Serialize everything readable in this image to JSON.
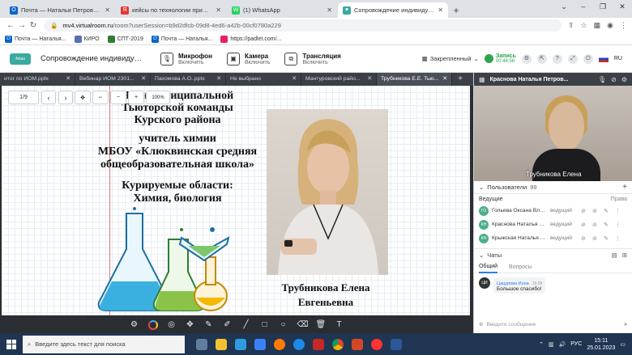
{
  "browser": {
    "tabs": [
      {
        "label": "Почта — Наталья Петровна Кра",
        "icon_color": "#0a64c8",
        "icon_text": "O"
      },
      {
        "label": "кейсы по технологии примеры",
        "icon_color": "#e53935",
        "icon_text": "Я"
      },
      {
        "label": "(1) WhatsApp",
        "icon_color": "#25d366",
        "icon_text": "W"
      },
      {
        "label": "Сопровождение индивидуальн",
        "icon_color": "#3aa9a0",
        "icon_text": "♥"
      }
    ],
    "url_domain": "mv4.virtualroom.ru",
    "url_rest": "/room?userSession=b9d2dfcb-09d8-4ed6-a42b-00cf0780a229",
    "bookmarks": [
      "Почта — Наталья...",
      "КИРО",
      "СПТ-2019",
      "Почта — Наталья...",
      "https://padlet.com/..."
    ]
  },
  "app": {
    "logo_text": "4stas",
    "title": "Сопровождение индивидуальн...",
    "controls": [
      {
        "title": "Микрофон",
        "sub": "Включить"
      },
      {
        "title": "Камера",
        "sub": "Включить"
      },
      {
        "title": "Трансляция",
        "sub": "Включить"
      }
    ],
    "pinned": "Закрепленный",
    "record_label": "Запись",
    "record_time": "00:48:56",
    "lang": "RU"
  },
  "doc_tabs": [
    "итог по ИОМ.pptx",
    "Вебинар ИОМ 2301...",
    "Пахомова А.О..pptx",
    "Не выбрано",
    "Мантуровский райо...",
    "Трубникова Е.Е. Тью..."
  ],
  "viewer": {
    "page": "1/9",
    "zoom": "100%"
  },
  "slide": {
    "lines": [
      "Член муниципальной",
      "Тьюторской команды",
      "Курского района",
      "учитель химии",
      "МБОУ «Клюквинская средняя",
      "общеобразовательная школа»",
      "Курируемые области:",
      "Химия, биология"
    ],
    "caption1": "Трубникова Елена",
    "caption2": "Евгеньевна"
  },
  "video": {
    "host_name": "Краснова Наталья Петров...",
    "participant": "Трубникова Елена"
  },
  "users": {
    "label": "Пользователи",
    "count": "99",
    "lead_label": "Ведущие",
    "rights_label": "Права",
    "list": [
      {
        "initials": "ГО",
        "name": "Гольева Оксана Влад...",
        "role": "ведущий"
      },
      {
        "initials": "КН",
        "name": "Краснова Наталья Пе...",
        "role": "ведущий"
      },
      {
        "initials": "КН",
        "name": "Крыжская Наталья А...",
        "role": "ведущий"
      }
    ]
  },
  "chat": {
    "label": "Чаты",
    "tab_general": "Общий",
    "tab_questions": "Вопросы",
    "message": {
      "initials": "ЦИ",
      "author": "Цацурова Инна",
      "time": "15:09",
      "text": "Большое спасибо!"
    },
    "input_placeholder": "Введите сообщение"
  },
  "taskbar": {
    "search_placeholder": "Введите здесь текст для поиска",
    "lang": "РУС",
    "time": "15:11",
    "date": "25.01.2023"
  }
}
